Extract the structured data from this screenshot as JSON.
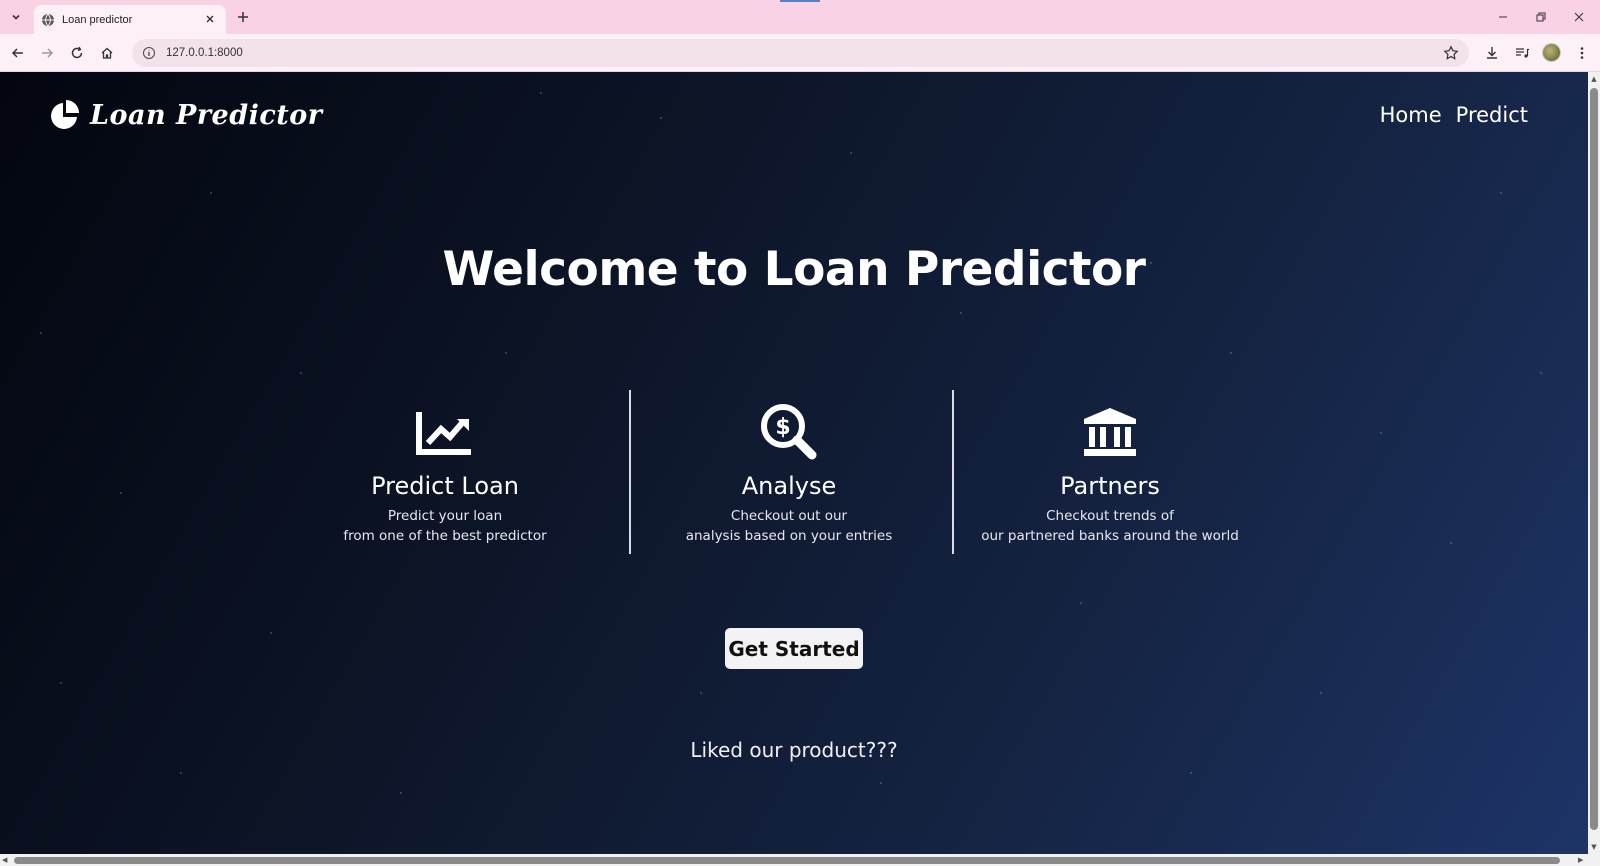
{
  "browser": {
    "tab_title": "Loan predictor",
    "url": "127.0.0.1:8000"
  },
  "site": {
    "brand": "Loan Predictor",
    "nav": [
      "Home",
      "Predict"
    ],
    "hero_title": "Welcome to Loan Predictor",
    "features": [
      {
        "icon": "chart-line-icon",
        "title": "Predict Loan",
        "desc_line1": "Predict your loan",
        "desc_line2": "from one of the best predictor"
      },
      {
        "icon": "search-dollar-icon",
        "title": "Analyse",
        "desc_line1": "Checkout out our",
        "desc_line2": "analysis based on your entries"
      },
      {
        "icon": "bank-icon",
        "title": "Partners",
        "desc_line1": "Checkout trends of",
        "desc_line2": "our partnered banks around the world"
      }
    ],
    "cta_label": "Get Started",
    "footer_text": "Liked our product???"
  },
  "colors": {
    "chrome_bg": "#f9d2e6",
    "page_bg_dark": "#03060f",
    "page_bg_light": "#1d3467"
  }
}
